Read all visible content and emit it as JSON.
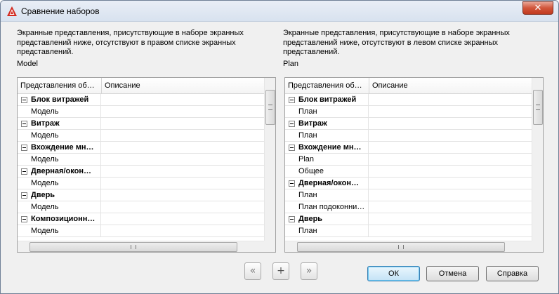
{
  "window": {
    "title": "Сравнение наборов"
  },
  "left": {
    "description": "Экранные представления, присутствующие в наборе экранных представлений ниже, отсутствуют в правом списке экранных представлений.",
    "set_name": "Model",
    "columns": [
      "Представления об…",
      "Описание"
    ],
    "rows": [
      {
        "type": "group",
        "label": "Блок витражей"
      },
      {
        "type": "item",
        "label": "Модель"
      },
      {
        "type": "group",
        "label": "Витраж"
      },
      {
        "type": "item",
        "label": "Модель"
      },
      {
        "type": "group",
        "label": "Вхождение мн…"
      },
      {
        "type": "item",
        "label": "Модель"
      },
      {
        "type": "group",
        "label": "Дверная/окон…"
      },
      {
        "type": "item",
        "label": "Модель"
      },
      {
        "type": "group",
        "label": "Дверь"
      },
      {
        "type": "item",
        "label": "Модель"
      },
      {
        "type": "group",
        "label": "Композиционн…"
      },
      {
        "type": "item",
        "label": "Модель"
      }
    ]
  },
  "right": {
    "description": "Экранные представления, присутствующие  в наборе экранных представлений ниже, отсутствуют в левом списке экранных представлений.",
    "set_name": "Plan",
    "columns": [
      "Представления об…",
      "Описание"
    ],
    "rows": [
      {
        "type": "group",
        "label": "Блок витражей"
      },
      {
        "type": "item",
        "label": "План"
      },
      {
        "type": "group",
        "label": "Витраж"
      },
      {
        "type": "item",
        "label": "План"
      },
      {
        "type": "group",
        "label": "Вхождение мн…"
      },
      {
        "type": "item",
        "label": "Plan"
      },
      {
        "type": "item",
        "label": "Общее"
      },
      {
        "type": "group",
        "label": "Дверная/окон…"
      },
      {
        "type": "item",
        "label": "План"
      },
      {
        "type": "item",
        "label": "План подоконни…"
      },
      {
        "type": "group",
        "label": "Дверь"
      },
      {
        "type": "item",
        "label": "План"
      }
    ]
  },
  "nav": {
    "move_left_glyph": "«",
    "add_glyph": "+",
    "move_right_glyph": "»"
  },
  "buttons": {
    "ok": "ОК",
    "cancel": "Отмена",
    "help": "Справка"
  },
  "icons": {
    "app": "autocad-a-icon",
    "close": "close-icon",
    "expander": "collapse-minus-icon"
  },
  "colors": {
    "app_icon_red": "#d32a1f",
    "close_red": "#c13a1f"
  }
}
